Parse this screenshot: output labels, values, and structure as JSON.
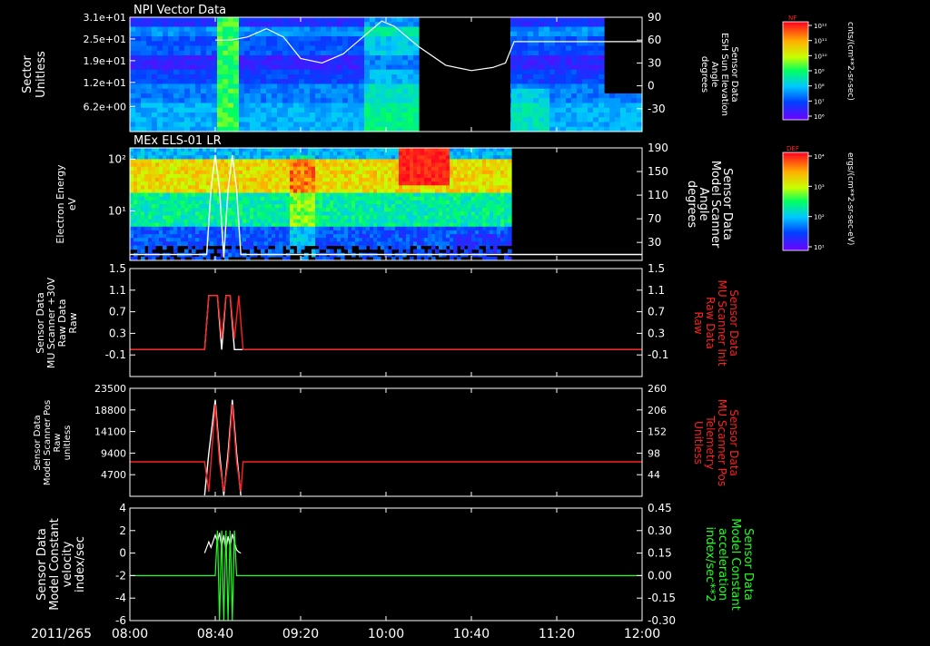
{
  "time_axis": {
    "ticks": [
      "08:00",
      "08:40",
      "09:20",
      "10:00",
      "10:40",
      "11:20",
      "12:00"
    ],
    "date_label": "2011/265",
    "xlim": [
      "08:00",
      "12:00"
    ]
  },
  "colorbars": [
    {
      "name": "NF",
      "unit_label": "cnts/(cm**2-sr-sec)",
      "ticks": [
        "10¹²",
        "10¹¹",
        "10¹⁰",
        "10⁹",
        "10⁸",
        "10⁷",
        "10⁶"
      ]
    },
    {
      "name": "DEF",
      "unit_label": "ergs/(cm**2-sr-sec-eV)",
      "ticks": [
        "10⁴",
        "10³",
        "10²",
        "10¹"
      ]
    }
  ],
  "chart_data": [
    {
      "type": "heatmap",
      "title": "NPI Vector Data",
      "ylabel": [
        "Sector",
        "Unitless"
      ],
      "yticks": [
        "3.1e+01",
        "2.5e+01",
        "1.9e+01",
        "1.2e+01",
        "6.2e+00"
      ],
      "y2label": [
        "Sensor Data",
        "ESH Sun Elevation",
        "Angle",
        "degrees"
      ],
      "y2ticks": [
        "90",
        "60",
        "30",
        "0",
        "-30"
      ],
      "y2lim": [
        -60,
        90
      ],
      "colorbar": "NF",
      "data_gap": [
        "10:15",
        "10:53"
      ],
      "overlay_line": {
        "name": "ESH Sun Elevation Angle",
        "color": "#ffffff",
        "x": [
          "08:40",
          "08:47",
          "08:55",
          "09:04",
          "09:12",
          "09:20",
          "09:30",
          "09:40",
          "09:50",
          "09:58",
          "10:04",
          "10:15",
          "10:28",
          "10:40",
          "10:50",
          "10:56",
          "11:00",
          "12:00"
        ],
        "y": [
          60,
          60,
          64,
          75,
          64,
          36,
          30,
          42,
          66,
          85,
          78,
          52,
          27,
          20,
          24,
          30,
          58,
          58
        ]
      }
    },
    {
      "type": "heatmap",
      "title": "MEx ELS-01 LR",
      "ylabel": [
        "Electron Energy",
        "eV"
      ],
      "yticks": [
        "10²",
        "10¹"
      ],
      "yscale": "log",
      "y2label": [
        "Sensor Data",
        "Model Scanner",
        "Angle",
        "degrees"
      ],
      "y2ticks": [
        "190",
        "150",
        "110",
        "70",
        "30"
      ],
      "y2lim": [
        0,
        190
      ],
      "colorbar": "DEF",
      "data_end": "10:58",
      "overlay_line": {
        "name": "Model Scanner Angle",
        "color": "#ffffff",
        "x": [
          "08:00",
          "08:35",
          "08:36",
          "08:38",
          "08:40",
          "08:42",
          "08:44",
          "08:46",
          "08:48",
          "08:50",
          "08:52",
          "12:00"
        ],
        "y": [
          10,
          10,
          10,
          120,
          178,
          120,
          5,
          120,
          178,
          120,
          10,
          10
        ]
      }
    },
    {
      "type": "line",
      "ylabel": [
        "Sensor Data",
        "MU Scanner +30V",
        "Raw Data",
        "Raw"
      ],
      "yticks": [
        "1.5",
        "1.1",
        "0.7",
        "0.3",
        "-0.1"
      ],
      "ylim": [
        -0.5,
        1.5
      ],
      "y2label": [
        "Sensor Data",
        "MU Scanner Init",
        "Raw Data",
        "Raw"
      ],
      "y2ticks": [
        "1.5",
        "1.1",
        "0.7",
        "0.3",
        "-0.1"
      ],
      "series": [
        {
          "color": "#ffffff",
          "x": [
            "08:00",
            "08:35",
            "08:37",
            "08:41",
            "08:43",
            "08:45",
            "08:47",
            "08:49",
            "08:51",
            "12:00"
          ],
          "y": [
            0,
            0,
            1,
            1,
            0,
            1,
            1,
            0,
            0,
            0
          ]
        },
        {
          "color": "#ff2020",
          "x": [
            "08:00",
            "08:35",
            "08:37",
            "08:41",
            "08:43",
            "08:45",
            "08:47",
            "08:49",
            "08:51",
            "08:53",
            "12:00"
          ],
          "y": [
            0,
            0,
            1,
            1,
            0.2,
            1,
            1,
            0.2,
            1,
            0,
            0
          ]
        }
      ]
    },
    {
      "type": "line",
      "ylabel": [
        "Sensor Data",
        "Model Scanner Pos",
        "Raw",
        "unitless"
      ],
      "yticks": [
        "23500",
        "18800",
        "14100",
        "9400",
        "4700"
      ],
      "ylim": [
        0,
        23500
      ],
      "y2label": [
        "Sensor Data",
        "MU Scanner Pos",
        "Telemetry",
        "Unitless"
      ],
      "y2ticks": [
        "260",
        "206",
        "152",
        "98",
        "44"
      ],
      "series": [
        {
          "color": "#ffffff",
          "x": [
            "08:35",
            "08:37",
            "08:40",
            "08:42",
            "08:44",
            "08:46",
            "08:48",
            "08:50",
            "08:52"
          ],
          "y": [
            200,
            9400,
            21000,
            9400,
            200,
            9400,
            21000,
            9400,
            200
          ]
        },
        {
          "color": "#ff2020",
          "x": [
            "08:00",
            "08:35",
            "08:37",
            "08:40",
            "08:42",
            "08:44",
            "08:46",
            "08:48",
            "08:50",
            "08:52",
            "08:53",
            "12:00"
          ],
          "y": [
            7500,
            7500,
            1000,
            20000,
            7500,
            1000,
            7500,
            20000,
            7500,
            1000,
            7500,
            7500
          ]
        }
      ]
    },
    {
      "type": "line",
      "ylabel": [
        "Sensor Data",
        "Model Constant",
        "velocity",
        "index/sec"
      ],
      "yticks": [
        "4",
        "2",
        "0",
        "-2",
        "-4",
        "-6"
      ],
      "ylim": [
        -6,
        4
      ],
      "y2label": [
        "Sensor Data",
        "Model Constant",
        "acceleration",
        "index/sec**2"
      ],
      "y2ticks": [
        "0.45",
        "0.30",
        "0.15",
        "0.00",
        "-0.15",
        "-0.30"
      ],
      "y2lim": [
        -0.3,
        0.45
      ],
      "series": [
        {
          "color": "#ffffff",
          "x": [
            "08:35",
            "08:37",
            "08:38",
            "08:40",
            "08:41",
            "08:42",
            "08:43",
            "08:44",
            "08:45",
            "08:46",
            "08:47",
            "08:48",
            "08:50",
            "08:51",
            "08:52"
          ],
          "y": [
            0,
            1,
            0.5,
            1.6,
            1,
            1.8,
            0.5,
            1.6,
            0.3,
            1.5,
            0.6,
            1.7,
            0.3,
            0.1,
            0
          ]
        },
        {
          "color": "#20ff20",
          "x": [
            "08:00",
            "08:40",
            "08:41",
            "08:42",
            "08:43",
            "08:44",
            "08:45",
            "08:46",
            "08:47",
            "08:48",
            "08:49",
            "08:50",
            "12:00"
          ],
          "y": [
            0,
            0,
            0.3,
            -0.3,
            0.3,
            -0.3,
            0.3,
            -0.3,
            0.3,
            -0.3,
            0.3,
            0,
            0
          ]
        }
      ]
    }
  ]
}
